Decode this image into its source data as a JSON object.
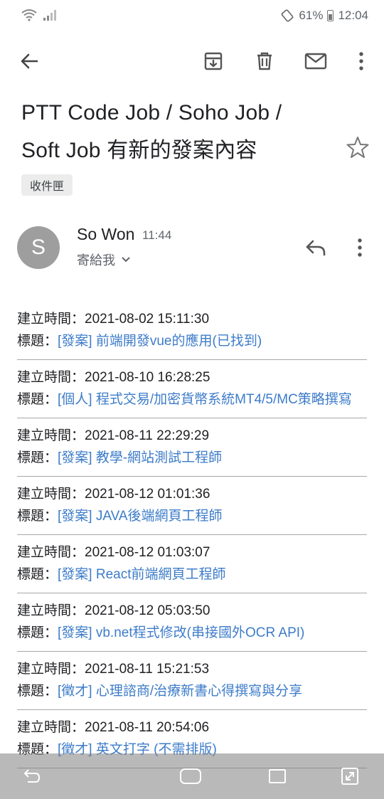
{
  "status_bar": {
    "battery": "61%",
    "time": "12:04"
  },
  "toolbar": {
    "back": "back-icon",
    "archive": "archive-icon",
    "delete": "trash-icon",
    "mark_unread": "mail-icon",
    "more": "more-vert-icon"
  },
  "subject": {
    "line1": "PTT Code Job / Soho Job /",
    "line2": "Soft Job 有新的發案內容",
    "label": "收件匣"
  },
  "sender": {
    "initial": "S",
    "name": "So Won",
    "time": "11:44",
    "to": "寄給我"
  },
  "entries": [
    {
      "time_label": "建立時間：",
      "time": "2021-08-02 15:11:30",
      "title_label": "標題：",
      "title": "[發案] 前端開發vue的應用(已找到)"
    },
    {
      "time_label": "建立時間：",
      "time": "2021-08-10 16:28:25",
      "title_label": "標題：",
      "title": "[個人] 程式交易/加密貨幣系統MT4/5/MC策略撰寫"
    },
    {
      "time_label": "建立時間：",
      "time": "2021-08-11 22:29:29",
      "title_label": "標題：",
      "title": "[發案] 教學-網站測試工程師"
    },
    {
      "time_label": "建立時間：",
      "time": "2021-08-12 01:01:36",
      "title_label": "標題：",
      "title": "[發案] JAVA後端網頁工程師"
    },
    {
      "time_label": "建立時間：",
      "time": "2021-08-12 01:03:07",
      "title_label": "標題：",
      "title": "[發案] React前端網頁工程師"
    },
    {
      "time_label": "建立時間：",
      "time": "2021-08-12 05:03:50",
      "title_label": "標題：",
      "title": "[發案] vb.net程式修改(串接國外OCR API)"
    },
    {
      "time_label": "建立時間：",
      "time": "2021-08-11 15:21:53",
      "title_label": "標題：",
      "title": "[徵才] 心理諮商/治療新書心得撰寫與分享"
    },
    {
      "time_label": "建立時間：",
      "time": "2021-08-11 20:54:06",
      "title_label": "標題：",
      "title": "[徵才] 英文打字 (不需排版)"
    }
  ],
  "colors": {
    "link": "#3d7cc9",
    "avatar": "#9e9e9e"
  }
}
